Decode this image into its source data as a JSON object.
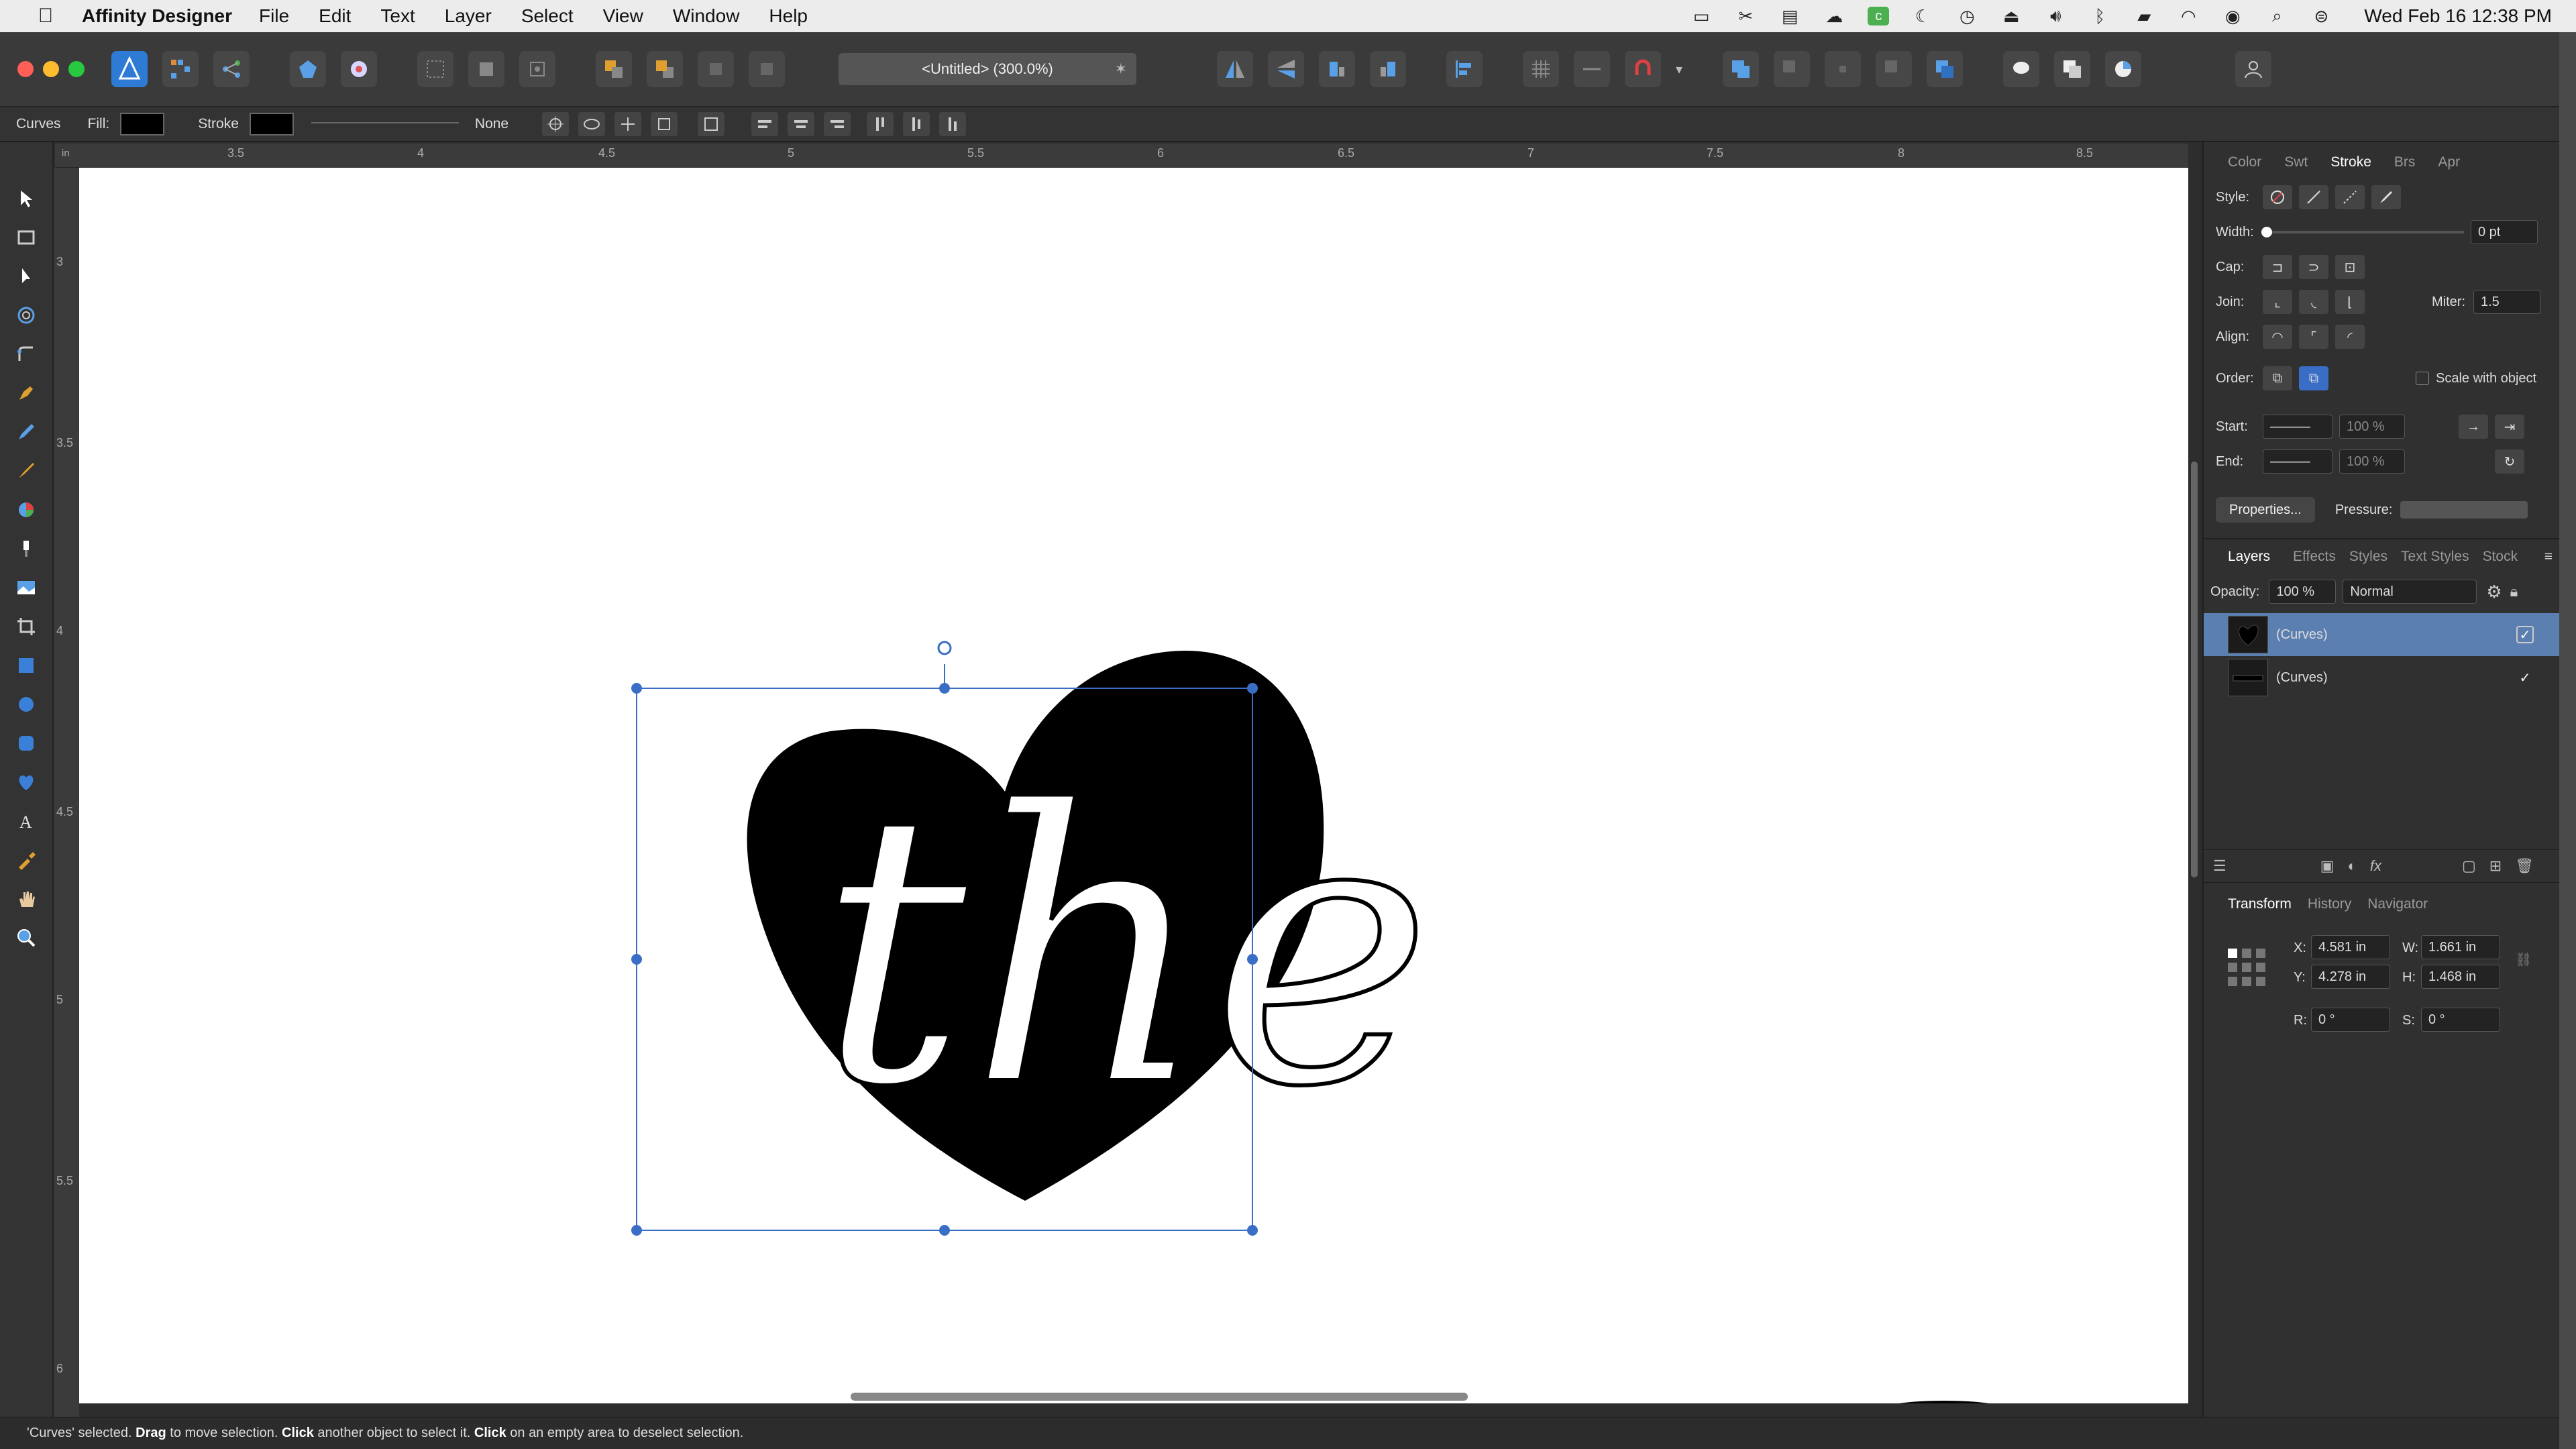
{
  "menubar": {
    "app_name": "Affinity Designer",
    "items": [
      "File",
      "Edit",
      "Text",
      "Layer",
      "Select",
      "View",
      "Window",
      "Help"
    ],
    "clock": "Wed Feb 16  12:38 PM"
  },
  "toolbar": {
    "document_title": "<Untitled> (300.0%)",
    "close_glyph": "✶"
  },
  "contextbar": {
    "object_type": "Curves",
    "fill_label": "Fill:",
    "stroke_label": "Stroke",
    "stroke_none": "None",
    "fill_color": "#000000",
    "stroke_color": "#000000"
  },
  "ruler": {
    "unit": "in",
    "h_ticks": [
      "3.5",
      "4",
      "4.5",
      "5",
      "5.5",
      "6",
      "6.5",
      "7",
      "7.5",
      "8",
      "8.5"
    ],
    "v_ticks": [
      "3",
      "3.5",
      "4",
      "4.5",
      "5",
      "5.5",
      "6"
    ]
  },
  "canvas": {
    "artwork_text": "the",
    "selection_color": "#3a6ec6"
  },
  "stroke_panel": {
    "tabs": [
      "Color",
      "Swt",
      "Stroke",
      "Brs",
      "Apr"
    ],
    "active_tab": "Stroke",
    "style_label": "Style:",
    "width_label": "Width:",
    "width_value": "0 pt",
    "cap_label": "Cap:",
    "join_label": "Join:",
    "miter_label": "Miter:",
    "miter_value": "1.5",
    "align_label": "Align:",
    "order_label": "Order:",
    "scale_with_object": "Scale with object",
    "start_label": "Start:",
    "end_label": "End:",
    "start_pct": "100 %",
    "end_pct": "100 %",
    "properties_button": "Properties...",
    "pressure_label": "Pressure:"
  },
  "layers_panel": {
    "tabs": [
      "Layers",
      "Effects",
      "Styles",
      "Text Styles",
      "Stock"
    ],
    "active_tab": "Layers",
    "opacity_label": "Opacity:",
    "opacity_value": "100 %",
    "blend_mode": "Normal",
    "layers": [
      {
        "name": "(Curves)",
        "selected": true,
        "visible": true
      },
      {
        "name": "(Curves)",
        "selected": false,
        "visible": true
      }
    ]
  },
  "transform_panel": {
    "tabs": [
      "Transform",
      "History",
      "Navigator"
    ],
    "active_tab": "Transform",
    "x_label": "X:",
    "x_value": "4.581 in",
    "y_label": "Y:",
    "y_value": "4.278 in",
    "w_label": "W:",
    "w_value": "1.661 in",
    "h_label": "H:",
    "h_value": "1.468 in",
    "r_label": "R:",
    "r_value": "0 °",
    "s_label": "S:",
    "s_value": "0 °"
  },
  "statusbar": {
    "part1": "'Curves' selected. ",
    "bold1": "Drag",
    "part2": " to move selection. ",
    "bold2": "Click",
    "part3": " another object to select it. ",
    "bold3": "Click",
    "part4": " on an empty area to deselect selection."
  },
  "colors": {
    "accent": "#2e7bd6",
    "layer_selected": "#5b7fb0",
    "close": "#fe5f57",
    "minimize": "#febc2e",
    "zoom": "#28c840"
  }
}
